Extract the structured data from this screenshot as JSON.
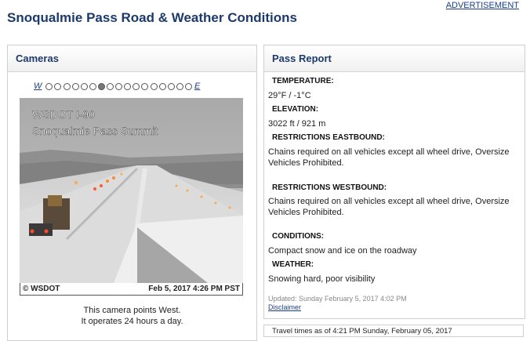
{
  "advertisement": "ADVERTISEMENT",
  "title": "Snoqualmie Pass Road & Weather Conditions",
  "cameras": {
    "heading": "Cameras",
    "west_label": "W",
    "east_label": "E",
    "dot_count": 17,
    "active_dot": 6,
    "image_text_line1": "WSDOT   I-90",
    "image_text_line2": "Snoqualmie Pass Summit",
    "credit": "© WSDOT",
    "timestamp": "Feb 5, 2017 4:26 PM PST",
    "caption_line1": "This camera points West.",
    "caption_line2": "It operates 24 hours a day."
  },
  "pass_report": {
    "heading": "Pass Report",
    "temperature_label": "TEMPERATURE:",
    "temperature_value": "29°F / -1°C",
    "elevation_label": "ELEVATION:",
    "elevation_value": "3022 ft / 921 m",
    "eastbound_label": "RESTRICTIONS EASTBOUND:",
    "eastbound_line1": "Chains required on all vehicles except all wheel drive, Oversize",
    "eastbound_line2": "Vehicles Prohibited.",
    "westbound_label": "RESTRICTIONS WESTBOUND:",
    "westbound_line1": "Chains required on all vehicles except all wheel drive, Oversize",
    "westbound_line2": "Vehicles Prohibited.",
    "conditions_label": "CONDITIONS:",
    "conditions_value": "Compact snow and ice on the roadway",
    "weather_label": "WEATHER:",
    "weather_value": "Snowing hard, poor visibility",
    "updated": "Updated: Sunday February 5, 2017 4:02 PM",
    "disclaimer": "Disclaimer"
  },
  "travel_times": "Travel times as of 4:21 PM Sunday, February 05, 2017"
}
